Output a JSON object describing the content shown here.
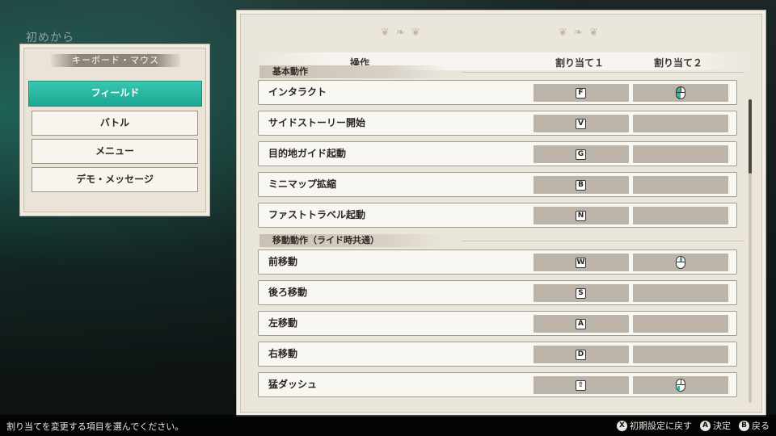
{
  "background_title": "初めから",
  "left_panel": {
    "header": "キーボード・マウス",
    "categories": [
      {
        "label": "フィールド",
        "active": true
      },
      {
        "label": "バトル",
        "active": false
      },
      {
        "label": "メニュー",
        "active": false
      },
      {
        "label": "デモ・メッセージ",
        "active": false
      }
    ]
  },
  "table": {
    "col_action": "操作",
    "col_assign1": "割り当て１",
    "col_assign2": "割り当て２",
    "sections": [
      {
        "title": "基本動作",
        "rows": [
          {
            "label": "インタラクト",
            "key1": "F",
            "key2_icon": "mouse-left-click-icon"
          },
          {
            "label": "サイドストーリー開始",
            "key1": "V",
            "key2_icon": ""
          },
          {
            "label": "目的地ガイド起動",
            "key1": "G",
            "key2_icon": ""
          },
          {
            "label": "ミニマップ拡縮",
            "key1": "B",
            "key2_icon": ""
          },
          {
            "label": "ファストトラベル起動",
            "key1": "N",
            "key2_icon": ""
          }
        ]
      },
      {
        "title": "移動動作（ライド時共通）",
        "rows": [
          {
            "label": "前移動",
            "key1": "W",
            "key2_icon": "mouse-wheel-icon"
          },
          {
            "label": "後ろ移動",
            "key1": "S",
            "key2_icon": ""
          },
          {
            "label": "左移動",
            "key1": "A",
            "key2_icon": ""
          },
          {
            "label": "右移動",
            "key1": "D",
            "key2_icon": ""
          },
          {
            "label": "猛ダッシュ",
            "key1": "⇧",
            "key2_icon": "mouse-side-button-icon"
          }
        ]
      }
    ]
  },
  "bottom_bar": {
    "hint": "割り当てを変更する項目を選んでください。",
    "actions": [
      {
        "button": "X",
        "label": "初期設定に戻す"
      },
      {
        "button": "A",
        "label": "決定"
      },
      {
        "button": "B",
        "label": "戻る"
      }
    ]
  },
  "colors": {
    "accent": "#1fb39c",
    "panel_bg": "#ebe6dc",
    "slot_bg": "#bdb4a9"
  }
}
